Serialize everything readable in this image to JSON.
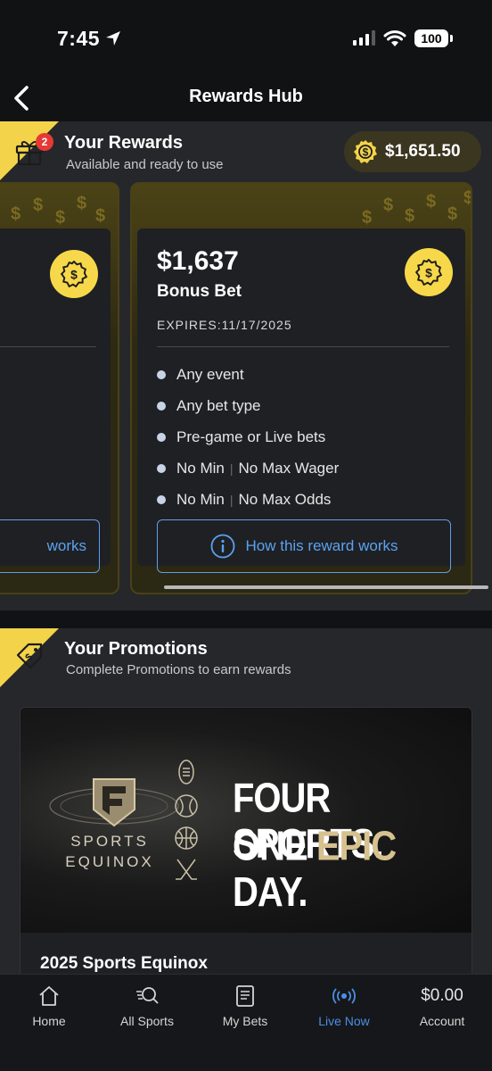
{
  "status_bar": {
    "time": "7:45",
    "battery": "100"
  },
  "header": {
    "title": "Rewards Hub"
  },
  "rewards": {
    "title": "Your Rewards",
    "subtitle": "Available and ready to use",
    "notification_count": "2",
    "balance": "$1,651.50",
    "left_card": {
      "button_label": "works"
    },
    "card": {
      "amount": "$1,637",
      "type": "Bonus Bet",
      "expires": "EXPIRES:11/17/2025",
      "features": [
        {
          "text": "Any event"
        },
        {
          "text": "Any bet type"
        },
        {
          "text": "Pre-game or Live bets"
        },
        {
          "a": "No Min",
          "b": "No Max Wager"
        },
        {
          "a": "No Min",
          "b": "No Max Odds"
        }
      ],
      "button_label": "How this reward works"
    }
  },
  "promotions": {
    "title": "Your Promotions",
    "subtitle": "Complete Promotions to earn rewards",
    "promo": {
      "brand_line1": "SPORTS",
      "brand_line2": "EQUINOX",
      "headline_line1": "FOUR SPORTS.",
      "headline_line2_a": "ONE",
      "headline_line2_epic": "EPIC",
      "headline_line2_b": "DAY.",
      "name": "2025 Sports Equinox"
    }
  },
  "tabbar": {
    "tabs": [
      {
        "label": "Home",
        "icon": "home-icon"
      },
      {
        "label": "All Sports",
        "icon": "search-sports-icon"
      },
      {
        "label": "My Bets",
        "icon": "bet-slip-icon"
      },
      {
        "label": "Live Now",
        "icon": "broadcast-icon",
        "active": true
      },
      {
        "label": "Account",
        "value": "$0.00"
      }
    ]
  },
  "colors": {
    "accent_blue": "#4a8fe6",
    "gold": "#f7d84a",
    "badge_red": "#e53935",
    "background": "#26272b"
  }
}
